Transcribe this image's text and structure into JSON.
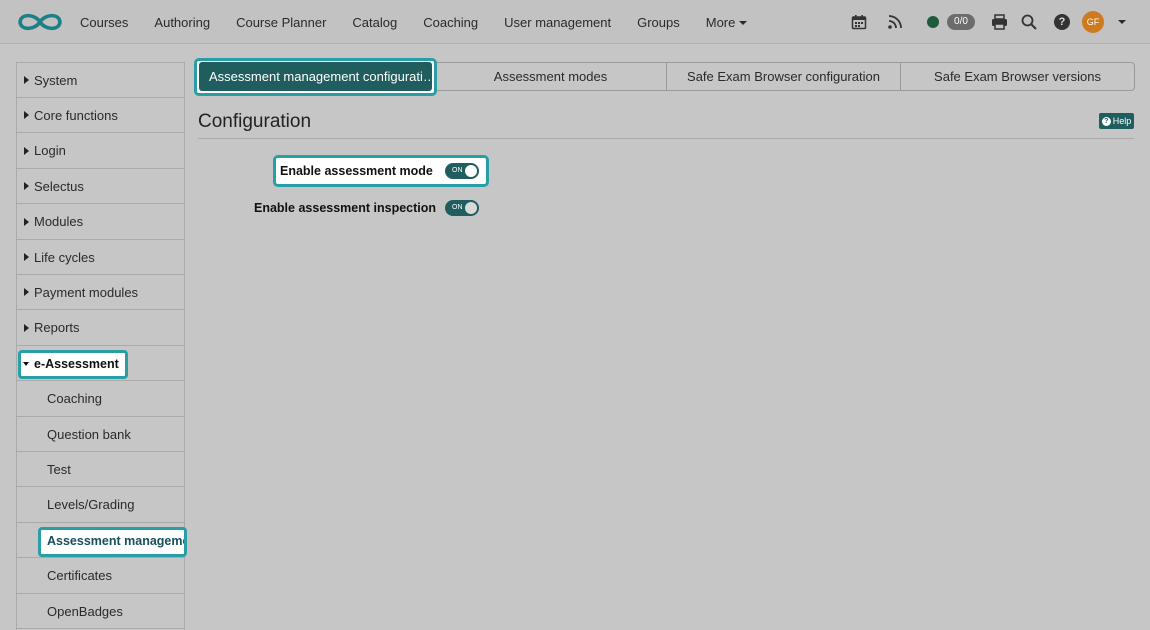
{
  "nav": {
    "items": [
      "Courses",
      "Authoring",
      "Course Planner",
      "Catalog",
      "Coaching",
      "User management",
      "Groups",
      "More"
    ],
    "badge": "0/0",
    "avatar_initials": "GF",
    "help_symbol": "?",
    "icons": [
      "calendar-icon",
      "rss-icon",
      "status-dot",
      "print-icon",
      "search-icon",
      "help-icon",
      "avatar",
      "chevron-down-icon"
    ]
  },
  "sidebar": {
    "items": [
      {
        "label": "System"
      },
      {
        "label": "Core functions"
      },
      {
        "label": "Login"
      },
      {
        "label": "Selectus"
      },
      {
        "label": "Modules"
      },
      {
        "label": "Life cycles"
      },
      {
        "label": "Payment modules"
      },
      {
        "label": "Reports"
      },
      {
        "label": "e-Assessment"
      }
    ],
    "subitems": [
      {
        "label": "Coaching"
      },
      {
        "label": "Question bank"
      },
      {
        "label": "Test"
      },
      {
        "label": "Levels/Grading"
      },
      {
        "label": "Assessment management"
      },
      {
        "label": "Certificates"
      },
      {
        "label": "OpenBadges"
      }
    ]
  },
  "tabs": [
    {
      "label": "Assessment management configurati…",
      "active": true
    },
    {
      "label": "Assessment modes"
    },
    {
      "label": "Safe Exam Browser configuration"
    },
    {
      "label": "Safe Exam Browser versions"
    }
  ],
  "main": {
    "title": "Configuration",
    "help_label": "Help",
    "settings": [
      {
        "label": "Enable assessment mode",
        "toggle": "ON",
        "enabled": true
      },
      {
        "label": "Enable assessment inspection",
        "toggle": "ON",
        "enabled": true
      }
    ]
  },
  "colors": {
    "accent": "#1f5d5e",
    "highlight": "#2a9ea6",
    "background": "#c6c6c6"
  }
}
